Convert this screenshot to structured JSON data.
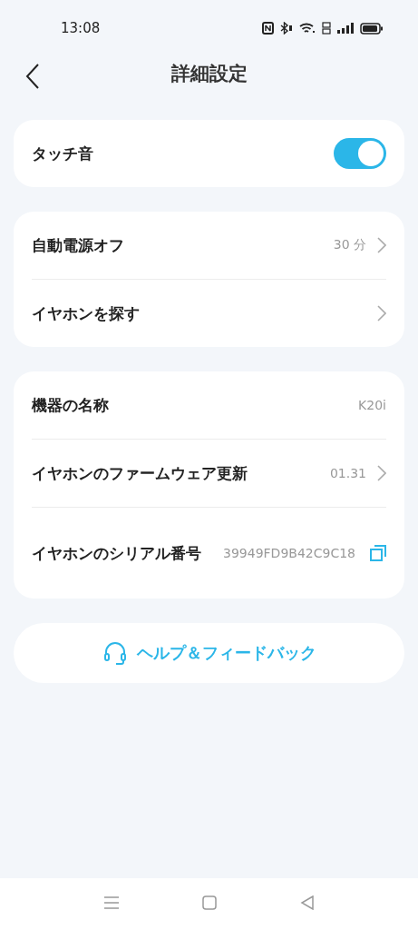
{
  "status_bar": {
    "time": "13:08"
  },
  "header": {
    "title": "詳細設定"
  },
  "groups": [
    {
      "rows": [
        {
          "kind": "toggle",
          "label": "タッチ音",
          "on": true
        }
      ]
    },
    {
      "rows": [
        {
          "kind": "nav",
          "label": "自動電源オフ",
          "value": "30 分"
        },
        {
          "kind": "nav",
          "label": "イヤホンを探す"
        }
      ]
    },
    {
      "rows": [
        {
          "kind": "info",
          "label": "機器の名称",
          "value": "K20i"
        },
        {
          "kind": "nav",
          "label": "イヤホンのファームウェア更新",
          "value": "01.31"
        },
        {
          "kind": "copy",
          "label": "イヤホンのシリアル番号",
          "value": "39949FD9B42C9C18"
        }
      ]
    }
  ],
  "help_button": {
    "label": "ヘルプ＆フィードバック"
  }
}
